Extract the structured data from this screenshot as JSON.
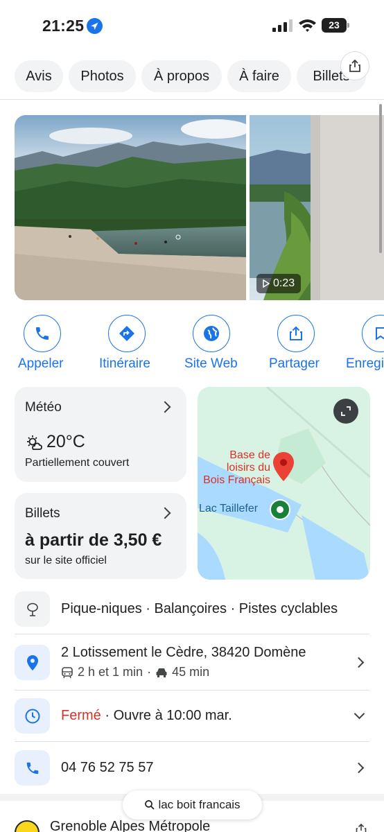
{
  "status_bar": {
    "time": "21:25",
    "battery": "23"
  },
  "tabs": [
    "Avis",
    "Photos",
    "À propos",
    "À faire",
    "Billets"
  ],
  "photos": {
    "video_duration": "0:23"
  },
  "actions": [
    {
      "label": "Appeler"
    },
    {
      "label": "Itinéraire"
    },
    {
      "label": "Site Web"
    },
    {
      "label": "Partager"
    },
    {
      "label": "Enregi"
    }
  ],
  "weather": {
    "title": "Météo",
    "temperature": "20°C",
    "condition": "Partiellement couvert"
  },
  "tickets": {
    "title": "Billets",
    "price": "à partir de 3,50 €",
    "source": "sur le site officiel"
  },
  "map": {
    "place_label_lines": [
      "Base de",
      "loisirs du",
      "Bois Français"
    ],
    "lake_label": "Lac Taillefer"
  },
  "amenities": {
    "text": "Pique-niques · Balançoires · Pistes cyclables"
  },
  "address": {
    "text": "2 Lotissement le Cèdre, 38420 Domène",
    "transit": "2 h et 1 min",
    "separator": "·",
    "drive": "45 min"
  },
  "hours": {
    "status": "Fermé",
    "detail": " · Ouvre à 10:00 mar."
  },
  "phone": {
    "number": "04 76 52 75 57"
  },
  "search": {
    "query": "lac boit francais"
  },
  "next_section": {
    "title": "Grenoble Alpes Métropole"
  },
  "colors": {
    "accent": "#1a73e8",
    "closed": "#d93025",
    "map_pin": "#ea4335",
    "map_water": "#aadaff",
    "map_land": "#d8f2e4"
  }
}
